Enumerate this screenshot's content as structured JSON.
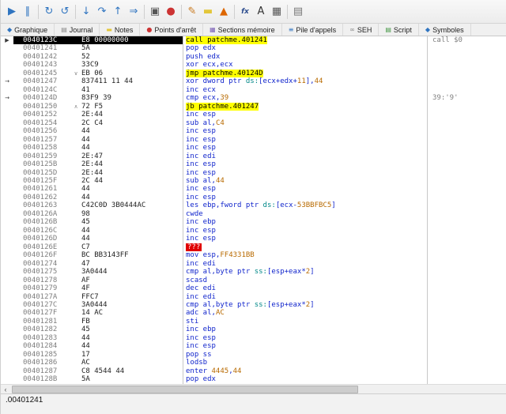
{
  "colors": {
    "highlight_yellow": "#ffff00",
    "selection_black": "#000000",
    "instruction_blue": "#1125cc",
    "number_orange": "#b86a00",
    "segment_teal": "#008888",
    "invalid_red": "#e00000",
    "address_gray": "#7e7e7e",
    "toolbar_blue": "#2f74c0"
  },
  "toolbar": {
    "groups": [
      [
        {
          "name": "run-icon",
          "glyph": "▶",
          "color": "#2f74c0"
        },
        {
          "name": "pause-icon",
          "glyph": "∥",
          "color": "#2f74c0"
        }
      ],
      [
        {
          "name": "restart-icon",
          "glyph": "↻",
          "color": "#2f74c0"
        },
        {
          "name": "close-icon",
          "glyph": "↺",
          "color": "#2f74c0"
        }
      ],
      [
        {
          "name": "step-into-icon",
          "glyph": "↓",
          "color": "#2f74c0"
        },
        {
          "name": "step-over-icon",
          "glyph": "↷",
          "color": "#2f74c0"
        },
        {
          "name": "step-out-icon",
          "glyph": "↑",
          "color": "#2f74c0"
        },
        {
          "name": "run-to-return-icon",
          "glyph": "⇒",
          "color": "#2f74c0"
        }
      ],
      [
        {
          "name": "trace-icon",
          "glyph": "▣",
          "color": "#555555"
        },
        {
          "name": "breakpoint-toggle-icon",
          "glyph": "●",
          "color": "#cc3333"
        }
      ],
      [
        {
          "name": "patch-icon",
          "glyph": "✎",
          "color": "#c97a20"
        },
        {
          "name": "notes-icon",
          "glyph": "▬",
          "color": "#e3c63a"
        },
        {
          "name": "hot-trace-icon",
          "glyph": "▲",
          "color": "#dd6600"
        }
      ],
      [
        {
          "name": "fx-icon",
          "glyph": "fx",
          "color": "#2f4f8f"
        },
        {
          "name": "font-icon",
          "glyph": "A",
          "color": "#333333"
        },
        {
          "name": "terminal-icon",
          "glyph": "▦",
          "color": "#555555"
        }
      ],
      [
        {
          "name": "memory-grid-icon",
          "glyph": "▤",
          "color": "#777777"
        }
      ]
    ]
  },
  "tabs": [
    {
      "name": "tab-graph",
      "label": "Graphique",
      "icon": "◆",
      "icon_color": "#2f74c0",
      "icon_name": "graph-icon"
    },
    {
      "name": "tab-journal",
      "label": "Journal",
      "icon": "▤",
      "icon_color": "#888888",
      "icon_name": "journal-icon"
    },
    {
      "name": "tab-notes",
      "label": "Notes",
      "icon": "▬",
      "icon_color": "#e3c63a",
      "icon_name": "note-icon"
    },
    {
      "name": "tab-breakpoints",
      "label": "Points d'arrêt",
      "icon": "●",
      "icon_color": "#cc3333",
      "icon_name": "breakpoint-dot-icon"
    },
    {
      "name": "tab-memory-map",
      "label": "Sections mémoire",
      "icon": "▦",
      "icon_color": "#7a5fb5",
      "icon_name": "memory-map-icon"
    },
    {
      "name": "tab-call-stack",
      "label": "Pile d'appels",
      "icon": "≡",
      "icon_color": "#2f74c0",
      "icon_name": "call-stack-icon"
    },
    {
      "name": "tab-seh",
      "label": "SEH",
      "icon": "∞",
      "icon_color": "#888888",
      "icon_name": "seh-chain-icon"
    },
    {
      "name": "tab-script",
      "label": "Script",
      "icon": "▤",
      "icon_color": "#4a9a4a",
      "icon_name": "script-icon"
    },
    {
      "name": "tab-symbols",
      "label": "Symboles",
      "icon": "◆",
      "icon_color": "#2f74c0",
      "icon_name": "symbols-icon"
    }
  ],
  "disasm": {
    "rows": [
      {
        "addr": "0040123C",
        "bytes": "E8 00000000",
        "instr": "call patchme.401241",
        "hl": true,
        "sel": true,
        "gutter": "eip",
        "comment": "call $0"
      },
      {
        "addr": "00401241",
        "bytes": "5A",
        "instr": "pop edx"
      },
      {
        "addr": "00401242",
        "bytes": "52",
        "instr": "push edx"
      },
      {
        "addr": "00401243",
        "bytes": "33C9",
        "instr": "xor ecx,ecx"
      },
      {
        "addr": "00401245",
        "bytes": "EB 06",
        "instr": "jmp patchme.40124D",
        "hl": true,
        "jump": "down"
      },
      {
        "addr": "00401247",
        "bytes": "837411 11 44",
        "instr": "xor dword ptr ds:[ecx+edx+11],44",
        "jump": "target"
      },
      {
        "addr": "0040124C",
        "bytes": "41",
        "instr": "inc ecx"
      },
      {
        "addr": "0040124D",
        "bytes": "83F9 39",
        "instr": "cmp ecx,39",
        "jump": "target",
        "comment": "39:'9'"
      },
      {
        "addr": "00401250",
        "bytes": "72 F5",
        "instr": "jb patchme.401247",
        "hl": true,
        "jump": "up"
      },
      {
        "addr": "00401252",
        "bytes": "2E:44",
        "instr": "inc esp"
      },
      {
        "addr": "00401254",
        "bytes": "2C C4",
        "instr": "sub al,C4"
      },
      {
        "addr": "00401256",
        "bytes": "44",
        "instr": "inc esp"
      },
      {
        "addr": "00401257",
        "bytes": "44",
        "instr": "inc esp"
      },
      {
        "addr": "00401258",
        "bytes": "44",
        "instr": "inc esp"
      },
      {
        "addr": "00401259",
        "bytes": "2E:47",
        "instr": "inc edi"
      },
      {
        "addr": "0040125B",
        "bytes": "2E:44",
        "instr": "inc esp"
      },
      {
        "addr": "0040125D",
        "bytes": "2E:44",
        "instr": "inc esp"
      },
      {
        "addr": "0040125F",
        "bytes": "2C 44",
        "instr": "sub al,44"
      },
      {
        "addr": "00401261",
        "bytes": "44",
        "instr": "inc esp"
      },
      {
        "addr": "00401262",
        "bytes": "44",
        "instr": "inc esp"
      },
      {
        "addr": "00401263",
        "bytes": "C42C0D 3B0444AC",
        "instr": "les ebp,fword ptr ds:[ecx-53BBFBC5]"
      },
      {
        "addr": "0040126A",
        "bytes": "98",
        "instr": "cwde"
      },
      {
        "addr": "0040126B",
        "bytes": "45",
        "instr": "inc ebp"
      },
      {
        "addr": "0040126C",
        "bytes": "44",
        "instr": "inc esp"
      },
      {
        "addr": "0040126D",
        "bytes": "44",
        "instr": "inc esp"
      },
      {
        "addr": "0040126E",
        "bytes": "C7",
        "instr": "???",
        "invalid": true
      },
      {
        "addr": "0040126F",
        "bytes": "BC BB3143FF",
        "instr": "mov esp,FF4331BB"
      },
      {
        "addr": "00401274",
        "bytes": "47",
        "instr": "inc edi"
      },
      {
        "addr": "00401275",
        "bytes": "3A0444",
        "instr": "cmp al,byte ptr ss:[esp+eax*2]"
      },
      {
        "addr": "00401278",
        "bytes": "AF",
        "instr": "scasd"
      },
      {
        "addr": "00401279",
        "bytes": "4F",
        "instr": "dec edi"
      },
      {
        "addr": "0040127A",
        "bytes": "FFC7",
        "instr": "inc edi"
      },
      {
        "addr": "0040127C",
        "bytes": "3A0444",
        "instr": "cmp al,byte ptr ss:[esp+eax*2]"
      },
      {
        "addr": "0040127F",
        "bytes": "14 AC",
        "instr": "adc al,AC"
      },
      {
        "addr": "00401281",
        "bytes": "FB",
        "instr": "sti"
      },
      {
        "addr": "00401282",
        "bytes": "45",
        "instr": "inc ebp"
      },
      {
        "addr": "00401283",
        "bytes": "44",
        "instr": "inc esp"
      },
      {
        "addr": "00401284",
        "bytes": "44",
        "instr": "inc esp"
      },
      {
        "addr": "00401285",
        "bytes": "17",
        "instr": "pop ss"
      },
      {
        "addr": "00401286",
        "bytes": "AC",
        "instr": "lodsb"
      },
      {
        "addr": "00401287",
        "bytes": "C8 4544 44",
        "instr": "enter 4445,44"
      },
      {
        "addr": "0040128B",
        "bytes": "5A",
        "instr": "pop edx"
      }
    ]
  },
  "scrollbar": {
    "left_arrow": "‹"
  },
  "status": {
    "address": ".00401241"
  }
}
